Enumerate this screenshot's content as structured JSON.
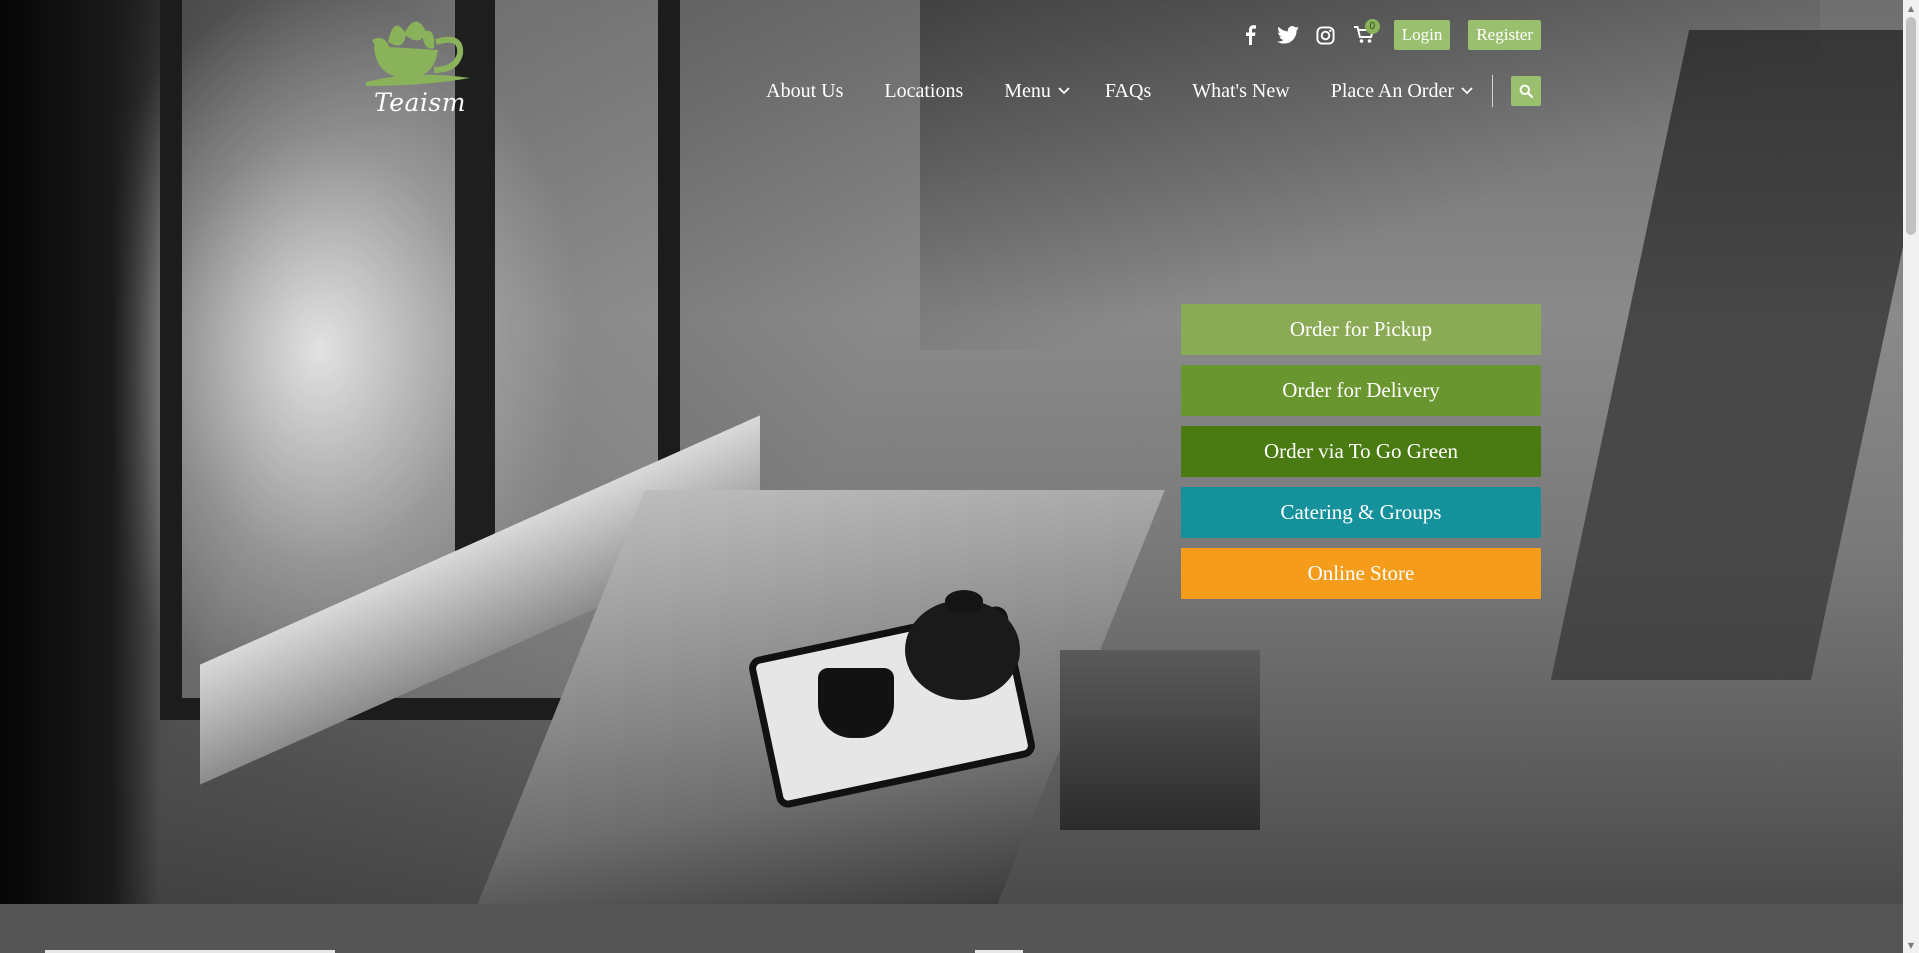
{
  "brand": {
    "logo_text": "Teaism",
    "logo_icon": "teacup-lotus-icon",
    "logo_color": "#8ab25a"
  },
  "topbar": {
    "social": [
      {
        "icon": "facebook-icon"
      },
      {
        "icon": "twitter-icon"
      },
      {
        "icon": "instagram-icon"
      }
    ],
    "cart": {
      "icon": "cart-icon",
      "count": "0"
    },
    "login_label": "Login",
    "register_label": "Register"
  },
  "nav": {
    "items": [
      {
        "label": "About Us",
        "dropdown": false
      },
      {
        "label": "Locations",
        "dropdown": false
      },
      {
        "label": "Menu",
        "dropdown": true
      },
      {
        "label": "FAQs",
        "dropdown": false
      },
      {
        "label": "What's New",
        "dropdown": false
      },
      {
        "label": "Place An Order",
        "dropdown": true
      }
    ],
    "search_icon": "search-icon"
  },
  "actions": [
    {
      "label": "Order for Pickup",
      "color": "#8aaa55"
    },
    {
      "label": "Order for Delivery",
      "color": "#6a9630"
    },
    {
      "label": "Order via To Go Green",
      "color": "#4a7a12"
    },
    {
      "label": "Catering & Groups",
      "color": "#14919b"
    },
    {
      "label": "Online Store",
      "color": "#f59d1a"
    }
  ],
  "colors": {
    "accent": "#9ac06f",
    "footer_band": "#555555"
  }
}
